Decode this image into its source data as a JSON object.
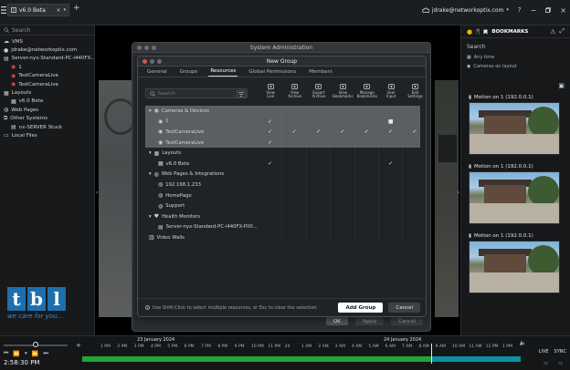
{
  "app": {
    "tab_title": "v6.0 Beta",
    "user": "jdrake@networkoptix.com",
    "bookmarks_label": "BOOKMARKS"
  },
  "left_tree": {
    "search_placeholder": "Search",
    "items": [
      {
        "label": "VMS",
        "icon": "cloud-icon",
        "indent": 0
      },
      {
        "label": "jdrake@networkoptix.com",
        "icon": "user-icon",
        "indent": 0
      },
      {
        "label": "Server-nyx-Standard-PC-i440FX...",
        "icon": "server-icon",
        "indent": 0
      },
      {
        "label": "1",
        "icon": "camera-icon",
        "indent": 1
      },
      {
        "label": "TestCameraLive",
        "icon": "camera-icon",
        "indent": 1
      },
      {
        "label": "TestCameraLive",
        "icon": "camera-icon",
        "indent": 1
      },
      {
        "label": "Layouts",
        "icon": "layout-icon",
        "indent": 0
      },
      {
        "label": "v6.0 Beta",
        "icon": "layout-icon",
        "indent": 1
      },
      {
        "label": "Web Pages",
        "icon": "globe-icon",
        "indent": 0
      },
      {
        "label": "Other Systems",
        "icon": "systems-icon",
        "indent": 0
      },
      {
        "label": "nx-SERVER Stuck",
        "icon": "server-icon",
        "indent": 1
      },
      {
        "label": "Local Files",
        "icon": "folder-icon",
        "indent": 0
      }
    ],
    "logo": {
      "letters": [
        "t",
        "b",
        "l"
      ],
      "slogan": "we care for you..."
    }
  },
  "right_panel": {
    "search_label": "Search",
    "chips": [
      "Any time",
      "Cameras on layout"
    ],
    "events": [
      {
        "title": "Motion on 1 (192.0.0.1)"
      },
      {
        "title": "Motion on 1 (192.0.0.1)"
      },
      {
        "title": "Motion on 1 (192.0.0.1)"
      }
    ]
  },
  "system_admin": {
    "title": "System Administration",
    "ok": "OK",
    "apply": "Apply",
    "cancel": "Cancel"
  },
  "new_group": {
    "title": "New Group",
    "tabs": [
      {
        "label": "General",
        "active": false
      },
      {
        "label": "Groups",
        "active": false
      },
      {
        "label": "Resources",
        "active": true
      },
      {
        "label": "Global Permissions",
        "active": false
      },
      {
        "label": "Members",
        "active": false
      }
    ],
    "search_placeholder": "Search",
    "permission_columns": [
      {
        "label": "View\nLive",
        "icon": "view-live-icon"
      },
      {
        "label": "View\nArchive",
        "icon": "view-archive-icon"
      },
      {
        "label": "Export\nArchive",
        "icon": "export-archive-icon"
      },
      {
        "label": "View\nBookmarks",
        "icon": "view-bookmarks-icon"
      },
      {
        "label": "Manage\nBookmarks",
        "icon": "manage-bookmarks-icon"
      },
      {
        "label": "User\nInput",
        "icon": "user-input-icon"
      },
      {
        "label": "Edit\nSettings",
        "icon": "edit-settings-icon"
      }
    ],
    "rows": [
      {
        "label": "Cameras & Devices",
        "icon": "camera-icon",
        "indent": 0,
        "expanded": true,
        "selected": true,
        "checks": [
          "",
          "",
          "",
          "",
          "",
          "",
          ""
        ]
      },
      {
        "label": "1",
        "icon": "camera-icon",
        "indent": 1,
        "selected": true,
        "checks": [
          "✓",
          "",
          "",
          "",
          "",
          "■",
          ""
        ]
      },
      {
        "label": "TestCameraLive",
        "icon": "camera-icon",
        "indent": 1,
        "selected": true,
        "checks": [
          "✓",
          "✓",
          "✓",
          "✓",
          "✓",
          "✓",
          "✓"
        ]
      },
      {
        "label": "TestCameraLive",
        "icon": "camera-icon",
        "indent": 1,
        "selected": true,
        "checks": [
          "✓",
          "",
          "",
          "",
          "",
          "",
          ""
        ]
      },
      {
        "label": "Layouts",
        "icon": "layout-icon",
        "indent": 0,
        "expanded": true,
        "selected": false,
        "checks": [
          "",
          "",
          "",
          "",
          "",
          "",
          ""
        ]
      },
      {
        "label": "v6.0 Beta",
        "icon": "layout-icon",
        "indent": 1,
        "selected": false,
        "checks": [
          "✓",
          "",
          "",
          "",
          "",
          "✓",
          ""
        ]
      },
      {
        "label": "Web Pages & Integrations",
        "icon": "globe-icon",
        "indent": 0,
        "expanded": true,
        "selected": false,
        "checks": [
          "",
          "",
          "",
          "",
          "",
          "",
          ""
        ]
      },
      {
        "label": "192.168.1.233",
        "icon": "globe-icon",
        "indent": 1,
        "selected": false,
        "checks": [
          "",
          "",
          "",
          "",
          "",
          "",
          ""
        ]
      },
      {
        "label": "HomePage",
        "icon": "globe-icon",
        "indent": 1,
        "selected": false,
        "checks": [
          "",
          "",
          "",
          "",
          "",
          "",
          ""
        ]
      },
      {
        "label": "Support",
        "icon": "globe-icon",
        "indent": 1,
        "selected": false,
        "checks": [
          "",
          "",
          "",
          "",
          "",
          "",
          ""
        ]
      },
      {
        "label": "Health Monitors",
        "icon": "health-icon",
        "indent": 0,
        "expanded": true,
        "selected": false,
        "checks": [
          "",
          "",
          "",
          "",
          "",
          "",
          ""
        ]
      },
      {
        "label": "Server-nyx-Standard-PC-i440FX-PIIX...",
        "icon": "server-icon",
        "indent": 1,
        "selected": false,
        "checks": [
          "",
          "",
          "",
          "",
          "",
          "",
          ""
        ]
      },
      {
        "label": "Video Walls",
        "icon": "videowall-icon",
        "indent": 0,
        "selected": false,
        "checks": [
          "",
          "",
          "",
          "",
          "",
          "",
          ""
        ]
      }
    ],
    "hint": "Use Shift-Click to select multiple resources, or Esc to clear the selection",
    "add_button": "Add Group",
    "cancel_button": "Cancel"
  },
  "timeline": {
    "dates": [
      "23 January 2024",
      "24 January 2024"
    ],
    "ticks": [
      "1 PM",
      "2 PM",
      "3 PM",
      "4 PM",
      "5 PM",
      "6 PM",
      "7 PM",
      "8 PM",
      "9 PM",
      "10 PM",
      "11 PM",
      "24",
      "1 AM",
      "2 AM",
      "3 AM",
      "4 AM",
      "5 AM",
      "6 AM",
      "7 AM",
      "8 AM",
      "9 AM",
      "10 AM",
      "11 AM",
      "12 PM",
      "1 PM"
    ],
    "clock": "2:58:30 PM",
    "live_label": "LIVE",
    "sync_label": "SYNC"
  },
  "colors": {
    "archive_green": "#26a336",
    "archive_teal": "#0e8fa4",
    "logo_blue": "#1d6fae",
    "accent_white": "#ffffff"
  }
}
